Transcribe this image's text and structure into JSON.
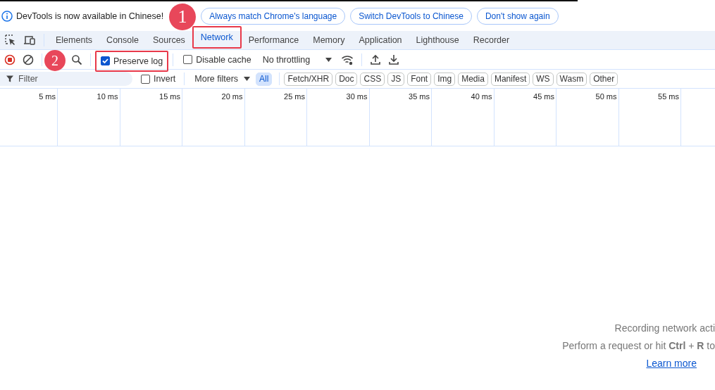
{
  "banner": {
    "message": "DevTools is now available in Chinese!",
    "buttons": [
      "Always match Chrome's language",
      "Switch DevTools to Chinese",
      "Don't show again"
    ]
  },
  "tabs": [
    {
      "label": "Elements",
      "selected": false,
      "highlighted": false
    },
    {
      "label": "Console",
      "selected": false,
      "highlighted": false
    },
    {
      "label": "Sources",
      "selected": false,
      "highlighted": false
    },
    {
      "label": "Network",
      "selected": true,
      "highlighted": true
    },
    {
      "label": "Performance",
      "selected": false,
      "highlighted": false
    },
    {
      "label": "Memory",
      "selected": false,
      "highlighted": false
    },
    {
      "label": "Application",
      "selected": false,
      "highlighted": false
    },
    {
      "label": "Lighthouse",
      "selected": false,
      "highlighted": false
    },
    {
      "label": "Recorder",
      "selected": false,
      "highlighted": false
    }
  ],
  "toolbar": {
    "checkboxes": [
      {
        "label": "Preserve log",
        "checked": true,
        "highlighted": true
      },
      {
        "label": "Disable cache",
        "checked": false,
        "highlighted": false
      }
    ],
    "throttling": "No throttling"
  },
  "filter_bar": {
    "placeholder": "Filter",
    "invert": {
      "label": "Invert",
      "checked": false
    },
    "more_filters": "More filters",
    "chips": [
      {
        "label": "All",
        "selected": true
      },
      {
        "label": "Fetch/XHR",
        "selected": false
      },
      {
        "label": "Doc",
        "selected": false
      },
      {
        "label": "CSS",
        "selected": false
      },
      {
        "label": "JS",
        "selected": false
      },
      {
        "label": "Font",
        "selected": false
      },
      {
        "label": "Img",
        "selected": false
      },
      {
        "label": "Media",
        "selected": false
      },
      {
        "label": "Manifest",
        "selected": false
      },
      {
        "label": "WS",
        "selected": false
      },
      {
        "label": "Wasm",
        "selected": false
      },
      {
        "label": "Other",
        "selected": false
      }
    ]
  },
  "timeline": {
    "ticks": [
      "5 ms",
      "10 ms",
      "15 ms",
      "20 ms",
      "25 ms",
      "30 ms",
      "35 ms",
      "40 ms",
      "45 ms",
      "50 ms",
      "55 ms"
    ]
  },
  "empty_state": {
    "title": "Recording network acti",
    "hint": "Perform a request or hit **Ctrl** + **R** to",
    "link": "Learn more"
  },
  "annotations": [
    {
      "label": "1"
    },
    {
      "label": "2"
    }
  ]
}
